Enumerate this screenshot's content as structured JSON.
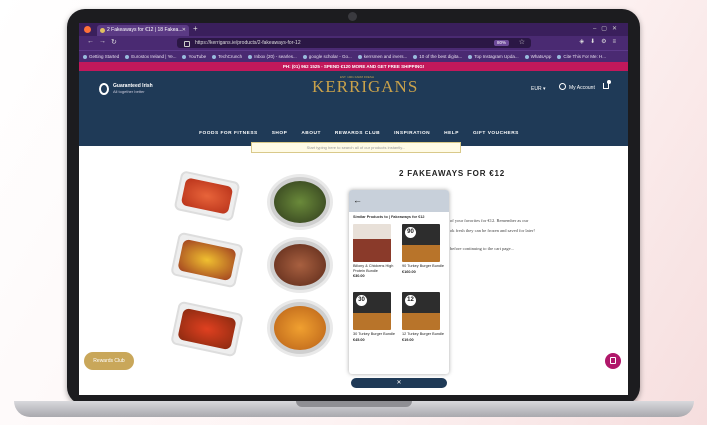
{
  "browser": {
    "tab_title": "2 Fakeaways for €12 | 18 Fakea...",
    "url": "https://kerrigans.ie/products/2-fakeaways-for-12",
    "zoom": "80%",
    "bookmarks": [
      "Getting Started",
      "Eurostox Ireland | Ye...",
      "YouTube",
      "TechCrunch",
      "Inbox (20) - searles...",
      "google scholar - Go...",
      "kerrsmen and irvers...",
      "10 of the best digita...",
      "Top Instagram Upda...",
      "WhatsApp",
      "Cite This For Me: H..."
    ]
  },
  "promo": "PH: (01) 962 1525 - SPEND €120 MORE AND GET FREE SHIPPING!",
  "header": {
    "gi_brand": "Guaranteed Irish",
    "gi_tag": "All together better",
    "brand_top": "EST. 1901 FARM FRESH",
    "brand": "KERRIGANS",
    "currency": "EUR ▾",
    "account": "My Account",
    "menu": [
      "FOODS FOR FITNESS",
      "SHOP",
      "ABOUT",
      "REWARDS CLUB",
      "INSPIRATION",
      "HELP",
      "GIFT VOUCHERS"
    ],
    "search_placeholder": "Start typing here to search all of our products instantly..."
  },
  "product": {
    "title": "2 FAKEAWAYS FOR €12",
    "desc_lines": [
      "of your favorites for €12. Remember as our",
      "ok fresh they can be frozen and saved for later!",
      "before continuing to the cart page..."
    ]
  },
  "popup": {
    "similar_label": "Similar Products to | Fakeaways for €12",
    "products": [
      {
        "badge": "",
        "name": "Billony & Chickens High Protein Bundle",
        "price": "€30.00"
      },
      {
        "badge": "90",
        "name": "90 Turkey Burger Bundle",
        "price": "€160.00"
      },
      {
        "badge": "30",
        "name": "30 Turkey Burger Bundle",
        "price": "€45.00"
      },
      {
        "badge": "12",
        "name": "12 Turkey Burger Bundle",
        "price": "€19.00"
      }
    ],
    "close": "✕"
  },
  "rewards": "Rewards Club",
  "colors": {
    "header": "#1f3a57",
    "promo": "#c2185b",
    "brand": "#caa24a",
    "chat": "#b0176a"
  }
}
